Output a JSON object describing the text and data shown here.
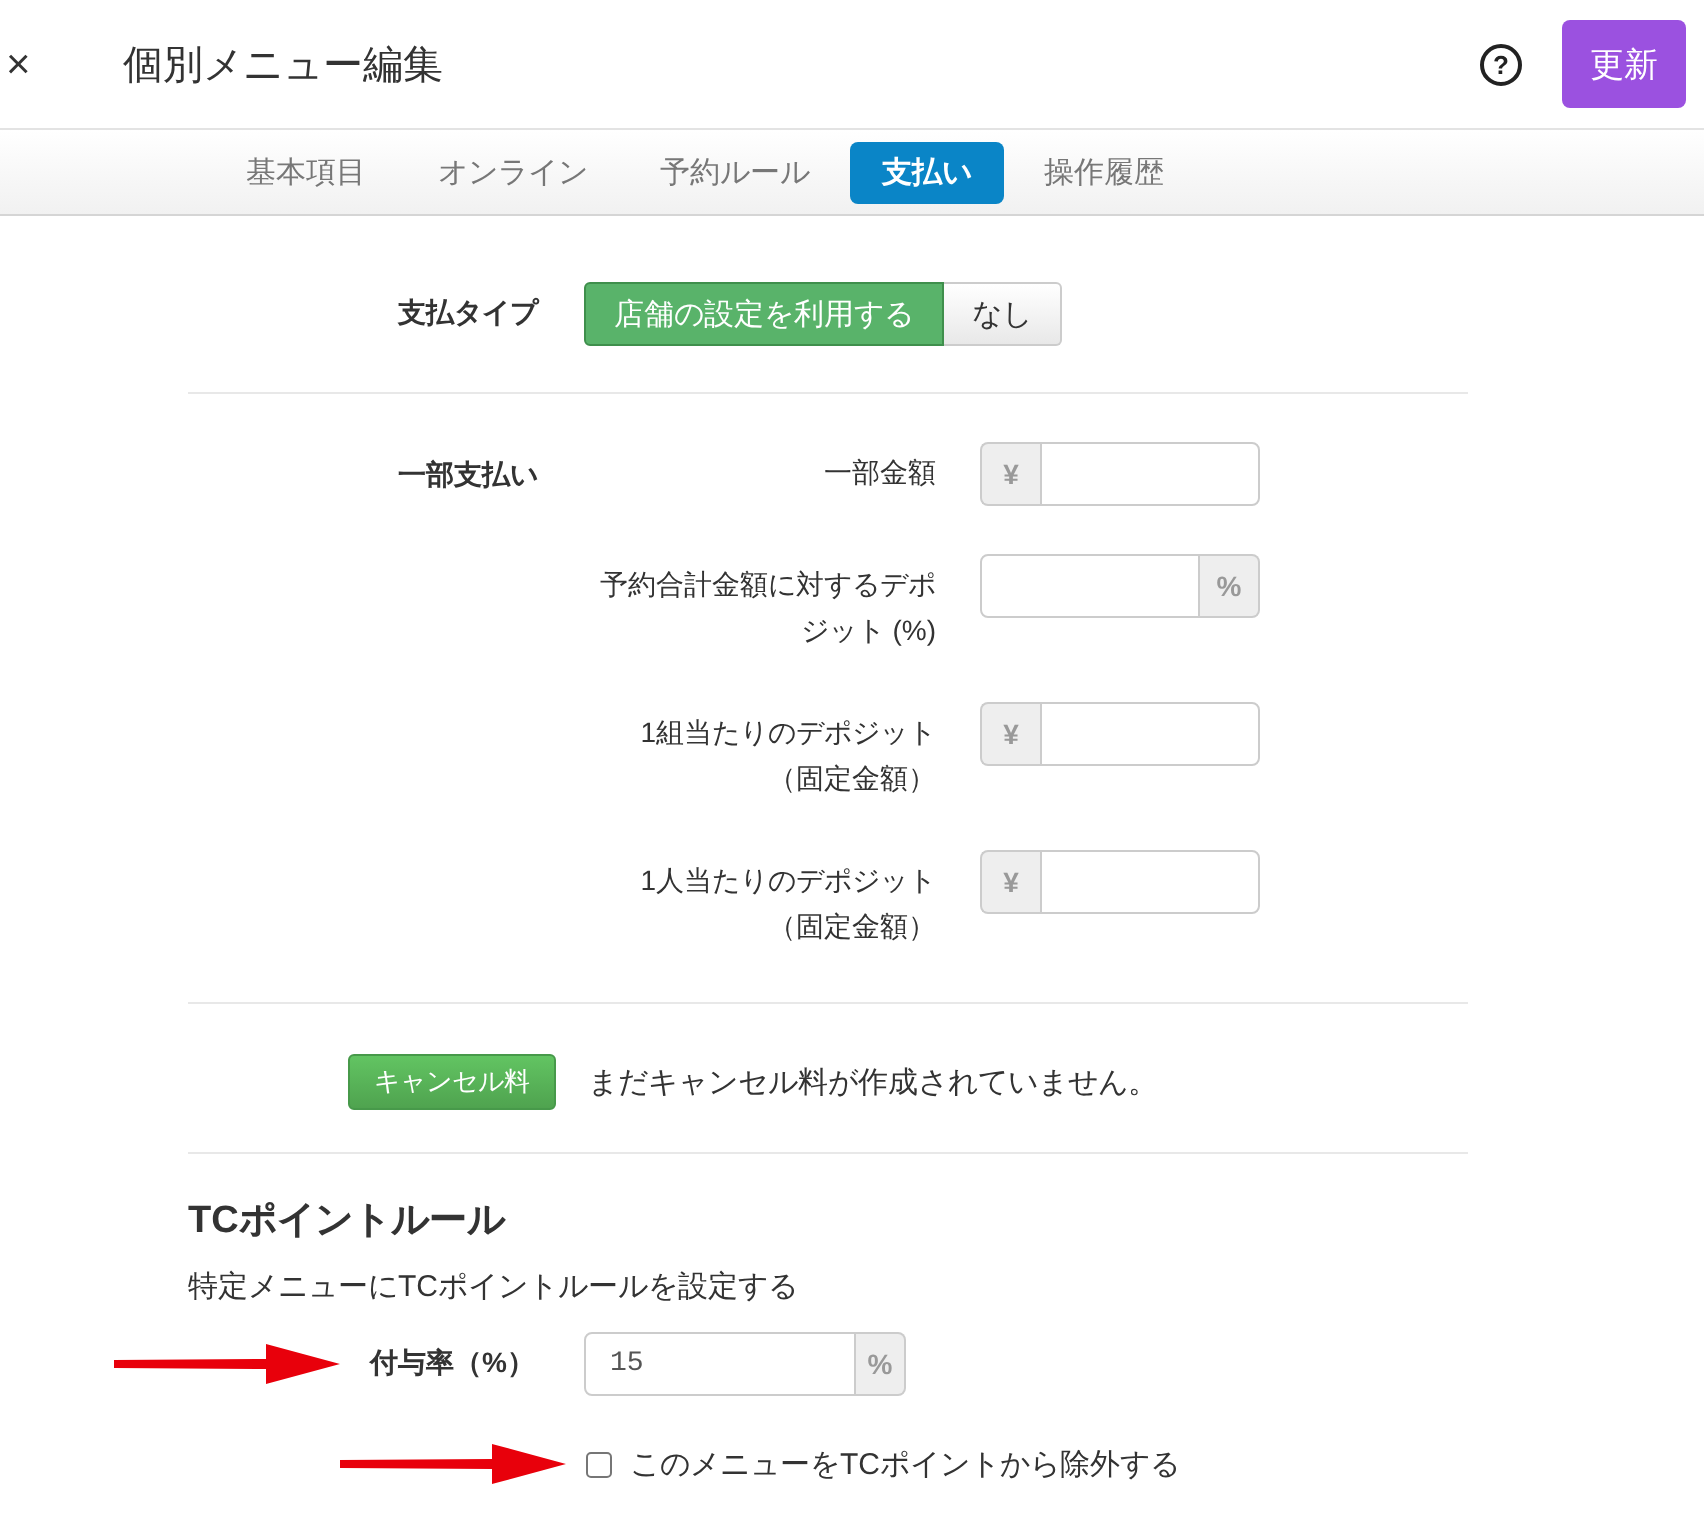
{
  "header": {
    "close_button": "×",
    "title": "個別メニュー編集",
    "help_button": "?",
    "update_button": "更新"
  },
  "tabs": [
    {
      "label": "基本項目",
      "selected": false
    },
    {
      "label": "オンライン",
      "selected": false
    },
    {
      "label": "予約ルール",
      "selected": false
    },
    {
      "label": "支払い",
      "selected": true
    },
    {
      "label": "操作履歴",
      "selected": false
    }
  ],
  "payment_type": {
    "label": "支払タイプ",
    "options": [
      {
        "label": "店舗の設定を利用する",
        "selected": true
      },
      {
        "label": "なし",
        "selected": false
      }
    ]
  },
  "partial_payment": {
    "label": "一部支払い",
    "fields": [
      {
        "label": "一部金額",
        "prefix": "¥"
      },
      {
        "label": "予約合計金額に対するデポジット (%)",
        "suffix": "%"
      },
      {
        "label": "1組当たりのデポジット（固定金額）",
        "prefix": "¥"
      },
      {
        "label": "1人当たりのデポジット（固定金額）",
        "prefix": "¥"
      }
    ]
  },
  "cancellation_fee": {
    "button": "キャンセル料",
    "message": "まだキャンセル料が作成されていません。"
  },
  "tc_point_rule": {
    "title": "TCポイントルール",
    "description": "特定メニューにTCポイントルールを設定する",
    "rate_field": {
      "label": "付与率（%）",
      "value": "15",
      "suffix": "%"
    },
    "exclude_checkbox": {
      "label": "このメニューをTCポイントから除外する",
      "checked": false
    }
  }
}
